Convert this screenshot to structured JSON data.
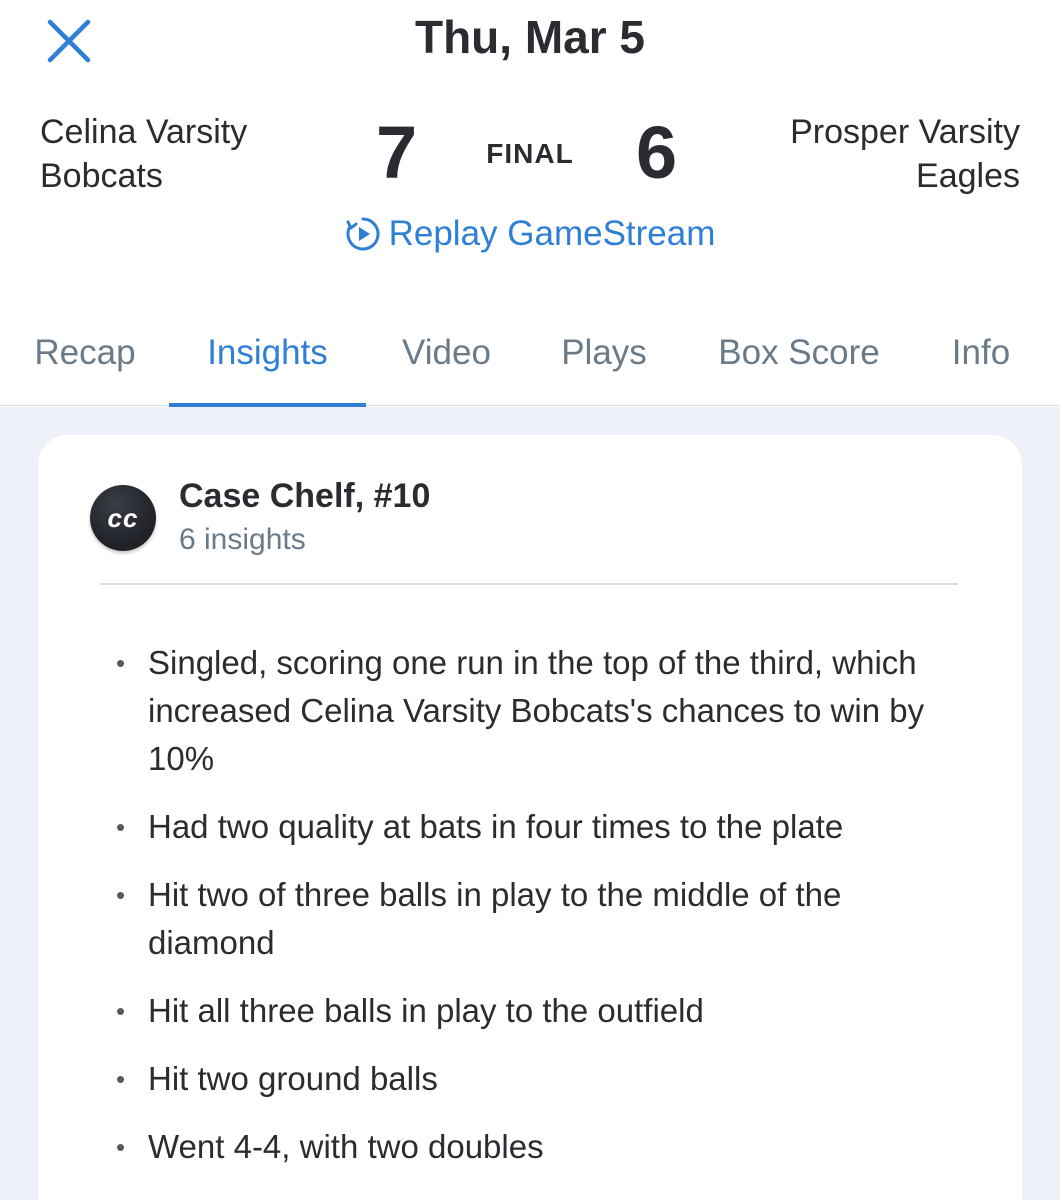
{
  "header": {
    "date": "Thu, Mar 5",
    "home_team": {
      "line1": "Celina Varsity",
      "line2": "Bobcats",
      "score": "7"
    },
    "away_team": {
      "line1": "Prosper Varsity",
      "line2": "Eagles",
      "score": "6"
    },
    "status": "FINAL",
    "replay_label": "Replay GameStream"
  },
  "tabs": [
    {
      "label": "Recap"
    },
    {
      "label": "Insights",
      "active": true
    },
    {
      "label": "Video"
    },
    {
      "label": "Plays"
    },
    {
      "label": "Box Score"
    },
    {
      "label": "Info"
    }
  ],
  "card": {
    "avatar_initials": "cc",
    "player_name": "Case Chelf, #10",
    "insight_count": "6 insights",
    "insights": [
      "Singled, scoring one run in the top of the third, which increased Celina Varsity Bobcats's chances to win by 10%",
      "Had two quality at bats in four times to the plate",
      "Hit two of three balls in play to the middle of the diamond",
      "Hit all three balls in play to the outfield",
      "Hit two ground balls",
      "Went 4-4, with two doubles"
    ]
  },
  "colors": {
    "accent": "#2f7fd6",
    "text": "#2a2c31",
    "muted": "#6b7a88",
    "content_bg": "#eef2f8"
  },
  "icons": {
    "close": "close-icon",
    "replay": "replay-play-icon",
    "avatar": "gamechanger-logo-icon"
  }
}
